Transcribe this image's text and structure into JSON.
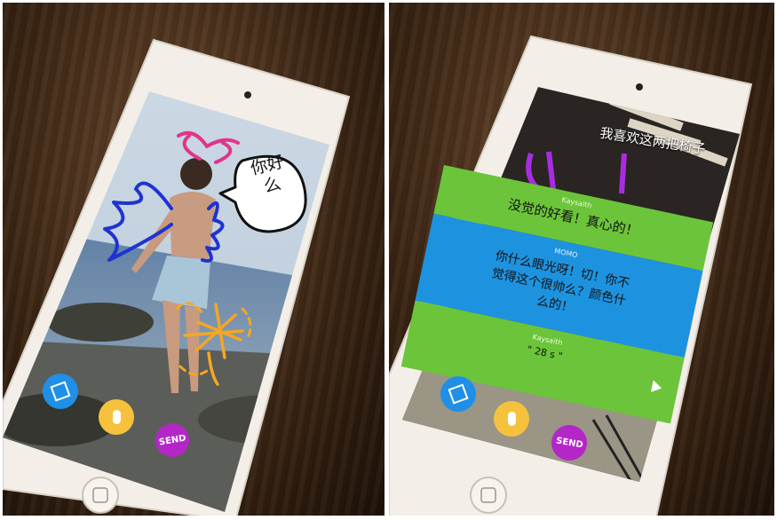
{
  "left_phone": {
    "drawn_text": "你好么",
    "send_label": "SEND",
    "colors": {
      "pen_button": "#1f8fe8",
      "mic_button": "#f6c23e",
      "send_button": "#b426c8",
      "doodle_pink": "#e0358a",
      "doodle_blue": "#1e33d0",
      "doodle_orange": "#f6a623"
    }
  },
  "right_phone": {
    "caption": "我喜欢这两把椅子",
    "messages": [
      {
        "sender": "Kaysaith",
        "text": "没觉的好看！真心的！",
        "color": "#6cc43a"
      },
      {
        "sender": "MOMO",
        "text_line1": "你什么眼光呀！切！你不",
        "text_line2": "觉得这个很帅么？颜色什",
        "text_line3": "么的！",
        "color": "#1d93e0"
      },
      {
        "sender": "Kaysaith",
        "voice_duration": "\" 28 s \"",
        "color": "#6cc43a"
      }
    ],
    "send_label": "SEND",
    "icons": {
      "play": "play-icon",
      "pen": "pen-icon",
      "mic": "microphone-icon"
    }
  }
}
